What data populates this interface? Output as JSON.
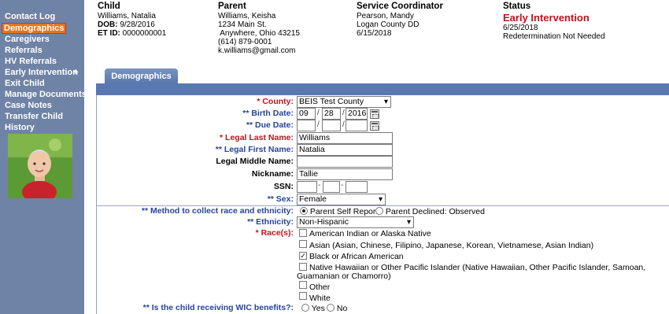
{
  "sidebar": {
    "items": [
      {
        "label": "Contact Log"
      },
      {
        "label": "Demographics"
      },
      {
        "label": "Caregivers"
      },
      {
        "label": "Referrals"
      },
      {
        "label": "HV Referrals"
      },
      {
        "label": "Early Intervention"
      },
      {
        "label": "Exit Child"
      },
      {
        "label": "Manage Documents"
      },
      {
        "label": "Case Notes"
      },
      {
        "label": "Transfer Child"
      },
      {
        "label": "History"
      }
    ],
    "expand_symbol": "+"
  },
  "header": {
    "child": {
      "title": "Child",
      "name": "Williams, Natalia",
      "dob_label": "DOB:",
      "dob": "9/28/2016",
      "etid_label": "ET ID:",
      "etid": "0000000001"
    },
    "parent": {
      "title": "Parent",
      "name": "Williams, Keisha",
      "addr1": "1234 Main St.",
      "addr2": " Anywhere, Ohio 43215",
      "phone": "(614) 879-0001",
      "email": "k.williams@gmail.com"
    },
    "coordinator": {
      "title": "Service Coordinator",
      "name": "Pearson, Mandy",
      "agency": "Logan County DD",
      "date": "6/15/2018"
    },
    "status": {
      "title": "Status",
      "main": "Early Intervention",
      "date": "6/25/2018",
      "note": "Redetermination Not Needed"
    }
  },
  "tab": {
    "label": "Demographics"
  },
  "form": {
    "county": {
      "label": "* County:",
      "value": "BEIS Test County"
    },
    "birth_date": {
      "label": "** Birth Date:",
      "month": "09",
      "day": "28",
      "year": "2016",
      "sep": "/"
    },
    "due_date": {
      "label": "** Due Date:",
      "sep": "/"
    },
    "last_name": {
      "label": "* Legal Last Name:",
      "value": "Williams"
    },
    "first_name": {
      "label": "** Legal First Name:",
      "value": "Natalia"
    },
    "middle_name": {
      "label": "Legal Middle Name:",
      "value": ""
    },
    "nickname": {
      "label": "Nickname:",
      "value": "Tallie"
    },
    "ssn": {
      "label": "SSN:",
      "sep": "-"
    },
    "sex": {
      "label": "** Sex:",
      "value": "Female"
    },
    "method": {
      "label": "** Method to collect race and ethnicity:",
      "opt1": "Parent Self Report",
      "opt2": "Parent Declined: Observed"
    },
    "ethnicity": {
      "label": "** Ethnicity:",
      "value": "Non-Hispanic"
    },
    "race": {
      "label": "* Race(s):",
      "options": [
        {
          "label": "American Indian or Alaska Native",
          "checked": false
        },
        {
          "label": "Asian (Asian, Chinese, Filipino, Japanese, Korean, Vietnamese, Asian Indian)",
          "checked": false
        },
        {
          "label": "Black or African American",
          "checked": true
        },
        {
          "label": "Native Hawaiian or Other Pacific Islander (Native Hawaiian, Other Pacific Islander, Samoan,",
          "checked": false
        },
        {
          "label": "Other",
          "checked": false
        },
        {
          "label": "White",
          "checked": false
        }
      ],
      "wrap_line": "Guamanian or Chamorro)",
      "check_glyph": "✓"
    },
    "wic": {
      "label": "** Is the child receiving WIC benefits?:",
      "yes": "Yes",
      "no": "No"
    }
  }
}
